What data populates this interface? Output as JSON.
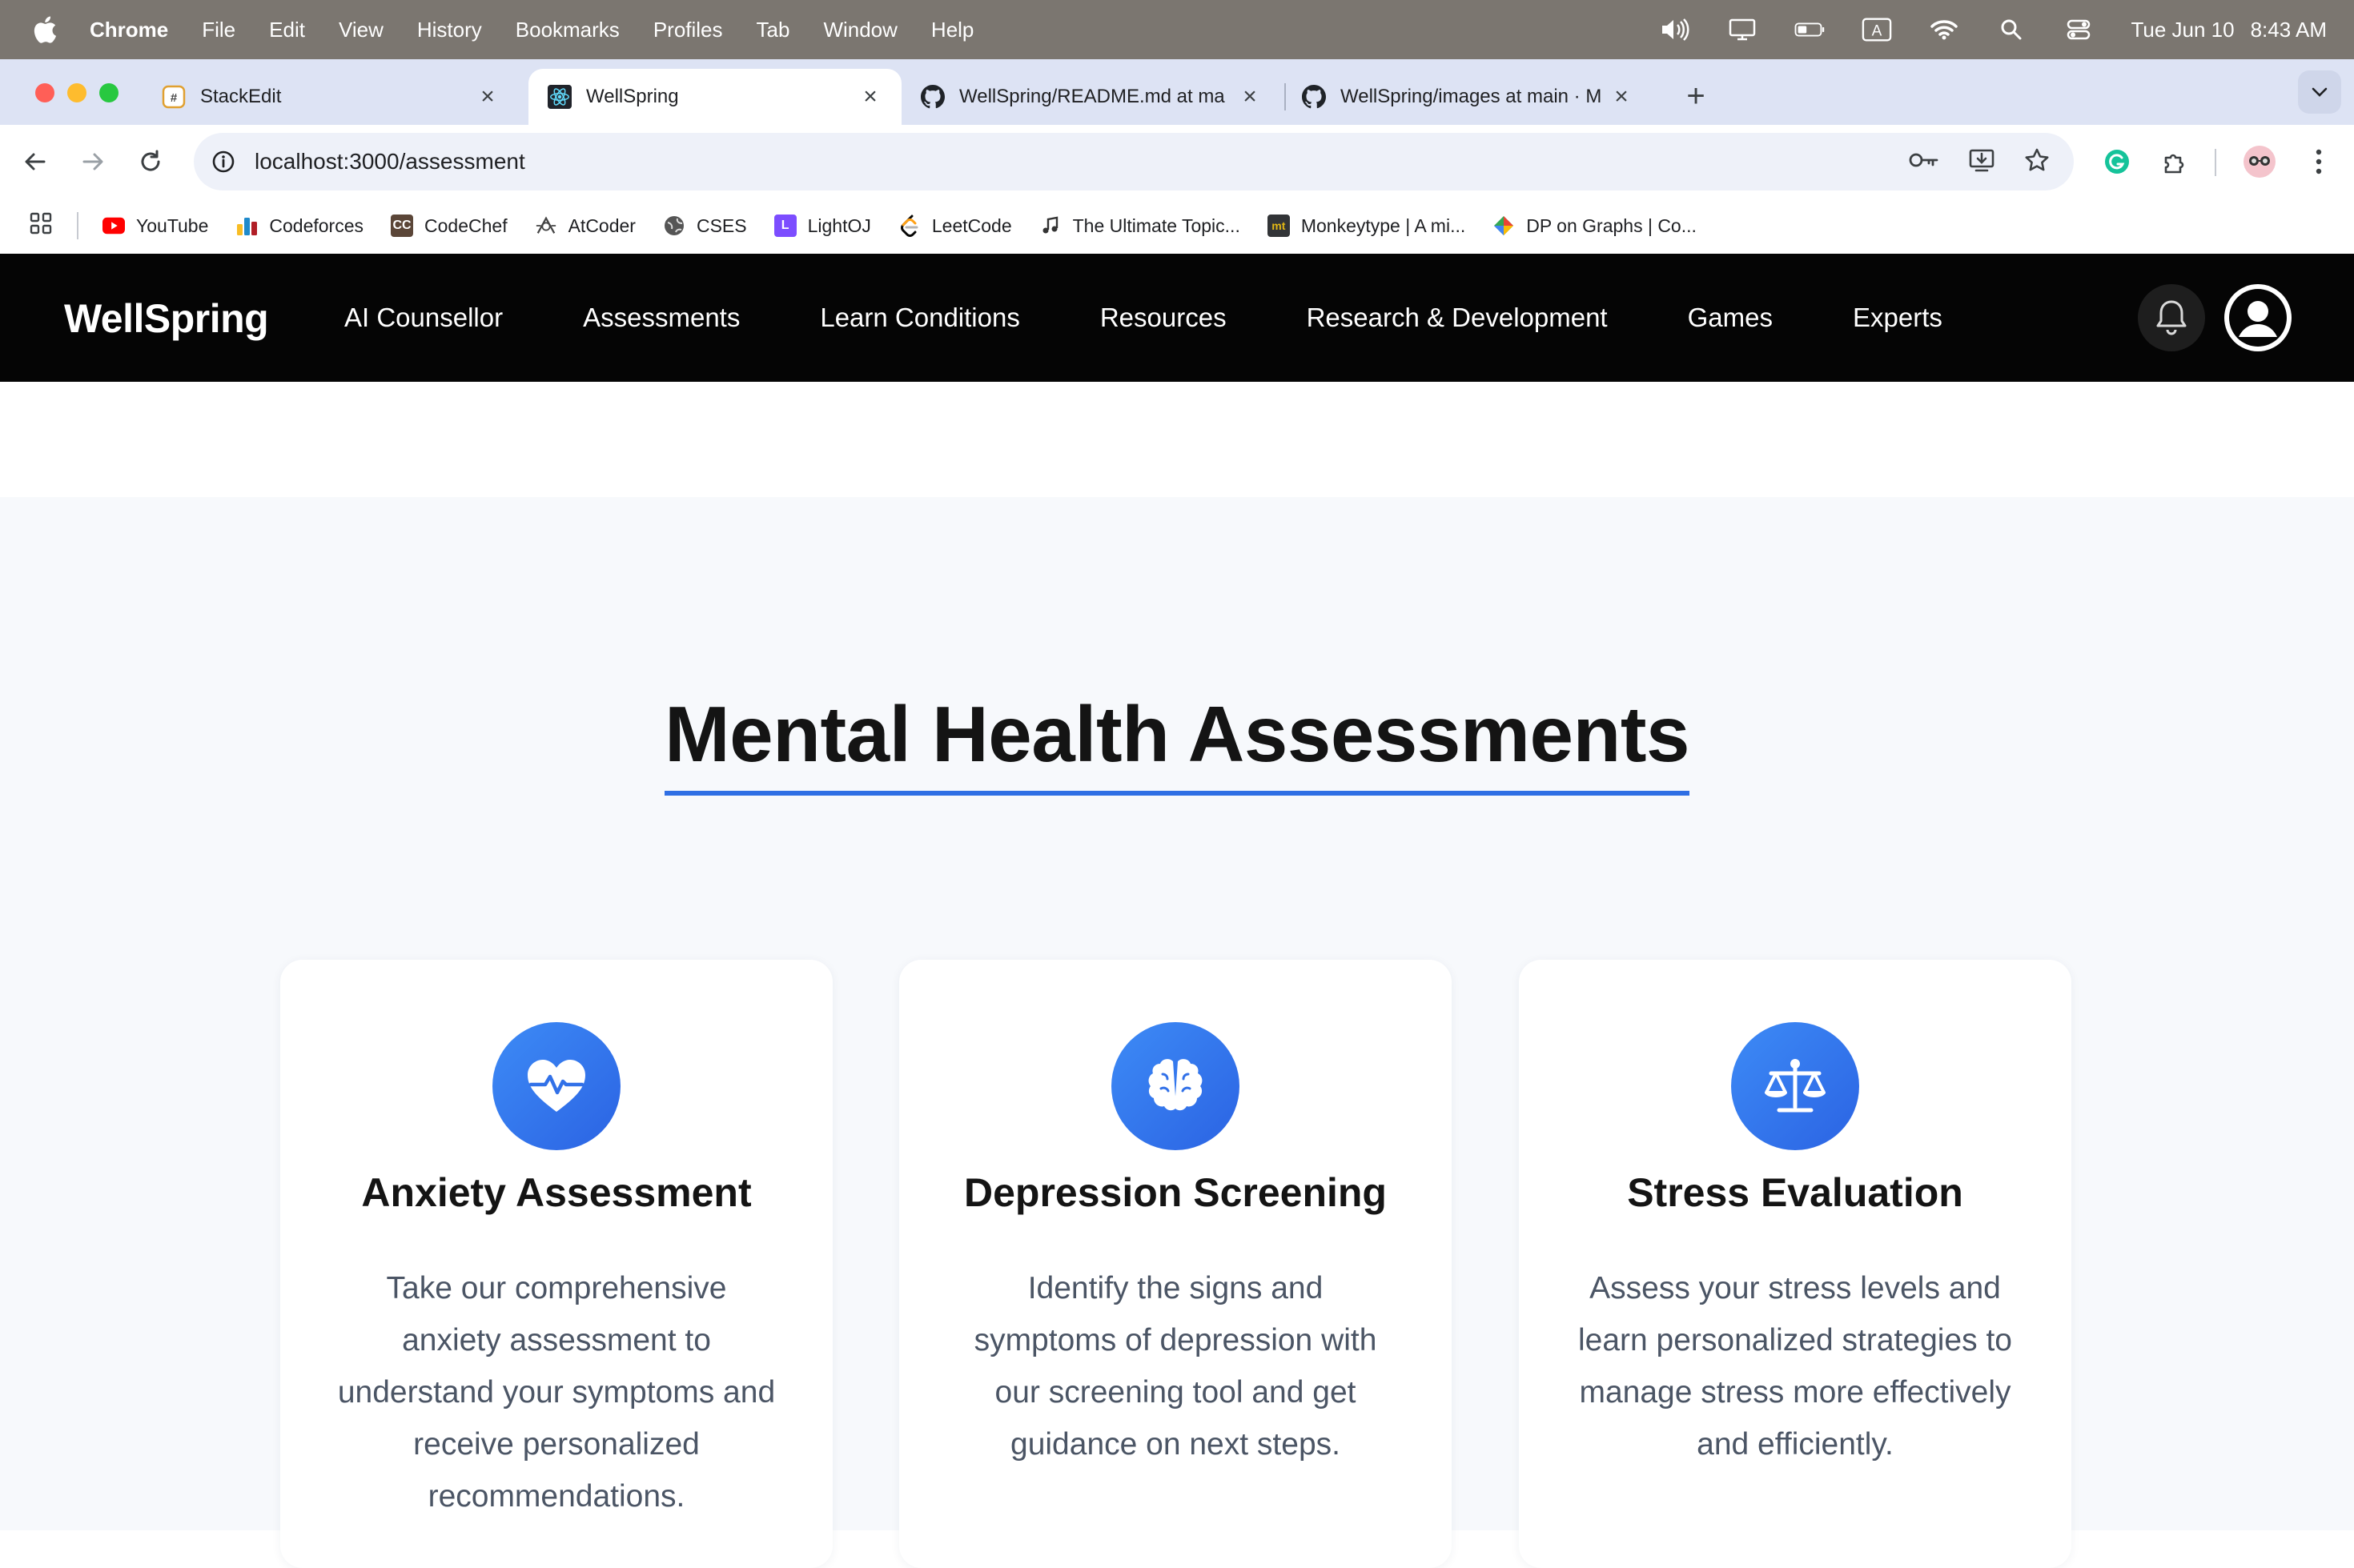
{
  "menubar": {
    "app_name": "Chrome",
    "items": [
      "File",
      "Edit",
      "View",
      "History",
      "Bookmarks",
      "Profiles",
      "Tab",
      "Window",
      "Help"
    ],
    "date": "Tue Jun 10",
    "time": "8:43 AM",
    "input_source": "A"
  },
  "tabs": [
    {
      "title": "StackEdit",
      "icon": "stackedit-icon"
    },
    {
      "title": "WellSpring",
      "icon": "react-icon"
    },
    {
      "title": "WellSpring/README.md at ma",
      "icon": "github-icon"
    },
    {
      "title": "WellSpring/images at main · M",
      "icon": "github-icon"
    }
  ],
  "toolbar": {
    "url": "localhost:3000/assessment"
  },
  "bookmarks": [
    {
      "label": "YouTube",
      "color": "#ff0000"
    },
    {
      "label": "Codeforces",
      "color": "#1f8acb"
    },
    {
      "label": "CodeChef",
      "color": "#5b4638"
    },
    {
      "label": "AtCoder",
      "color": "#444444"
    },
    {
      "label": "CSES",
      "color": "#444444"
    },
    {
      "label": "LightOJ",
      "color": "#7c4dff"
    },
    {
      "label": "LeetCode",
      "color": "#ffa116"
    },
    {
      "label": "The Ultimate Topic...",
      "color": "#333333"
    },
    {
      "label": "Monkeytype | A mi...",
      "color": "#e2b714"
    },
    {
      "label": "DP on Graphs | Co...",
      "color": "#34a853"
    }
  ],
  "site": {
    "brand": "WellSpring",
    "nav": [
      "AI Counsellor",
      "Assessments",
      "Learn Conditions",
      "Resources",
      "Research & Development",
      "Games",
      "Experts"
    ]
  },
  "page": {
    "heading": "Mental Health Assessments",
    "accent": "#2f6fe4",
    "cards": [
      {
        "icon": "heart-pulse-icon",
        "title": "Anxiety Assessment",
        "description": "Take our comprehensive anxiety assessment to understand your symptoms and receive personalized recommendations."
      },
      {
        "icon": "brain-icon",
        "title": "Depression Screening",
        "description": "Identify the signs and symptoms of depression with our screening tool and get guidance on next steps."
      },
      {
        "icon": "scale-icon",
        "title": "Stress Evaluation",
        "description": "Assess your stress levels and learn personalized strategies to manage stress more effectively and efficiently."
      }
    ]
  }
}
